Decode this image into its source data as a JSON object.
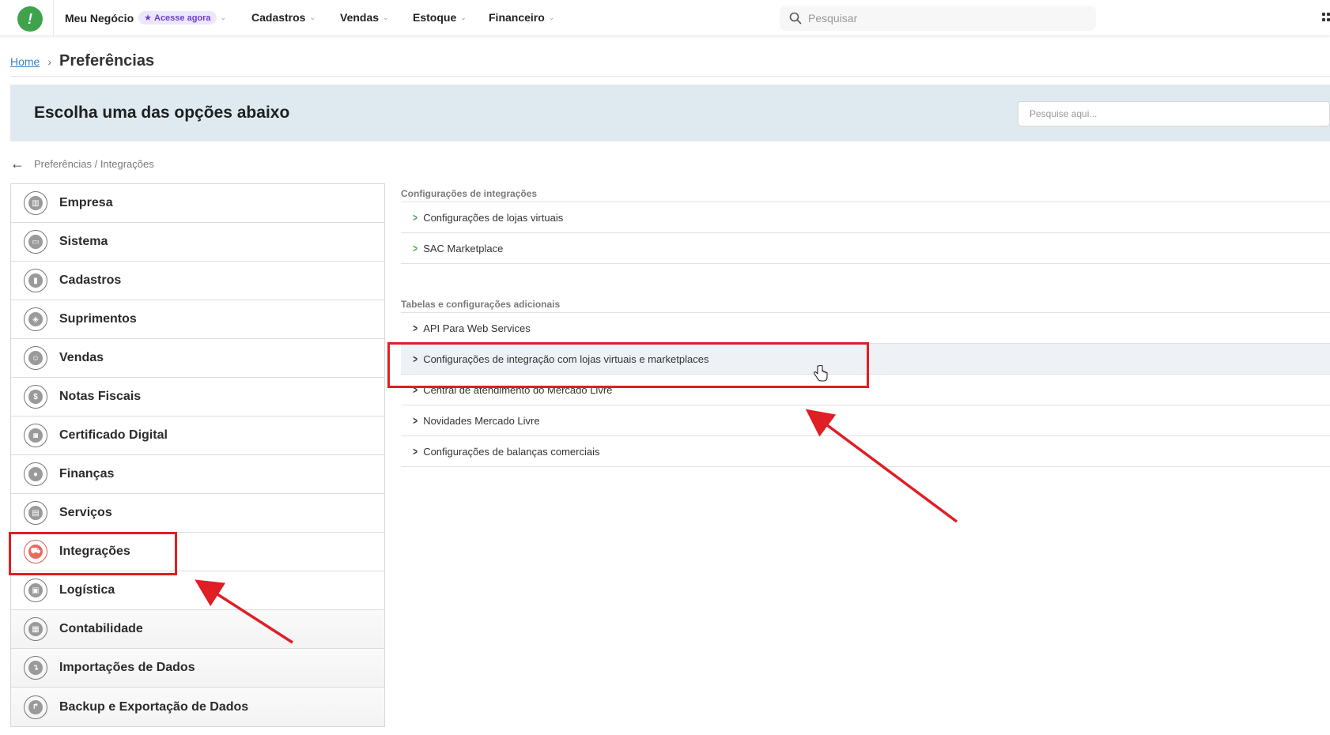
{
  "topnav": {
    "logo_glyph": "!",
    "items": [
      {
        "label": "Meu Negócio",
        "badge": "Acesse agora"
      },
      {
        "label": "Cadastros"
      },
      {
        "label": "Vendas"
      },
      {
        "label": "Estoque"
      },
      {
        "label": "Financeiro"
      }
    ],
    "search_placeholder": "Pesquisar",
    "badge_icon": "star-icon",
    "chevron_icon": "chevron-down-icon"
  },
  "breadcrumb": {
    "home": "Home",
    "current": "Preferências"
  },
  "header": {
    "title": "Escolha uma das opções abaixo",
    "search_placeholder": "Pesquise aqui..."
  },
  "sub_breadcrumb": {
    "path": "Preferências / Integrações"
  },
  "menu": {
    "items": [
      {
        "label": "Empresa",
        "icon": "building-icon",
        "glyph": "▥"
      },
      {
        "label": "Sistema",
        "icon": "monitor-icon",
        "glyph": "▭"
      },
      {
        "label": "Cadastros",
        "icon": "book-icon",
        "glyph": "▮"
      },
      {
        "label": "Suprimentos",
        "icon": "box-icon",
        "glyph": "◈"
      },
      {
        "label": "Vendas",
        "icon": "user-dollar-icon",
        "glyph": "☺"
      },
      {
        "label": "Notas Fiscais",
        "icon": "invoice-icon",
        "glyph": "$"
      },
      {
        "label": "Certificado Digital",
        "icon": "lock-icon",
        "glyph": "◙"
      },
      {
        "label": "Finanças",
        "icon": "piggy-bank-icon",
        "glyph": "●"
      },
      {
        "label": "Serviços",
        "icon": "document-icon",
        "glyph": "▤"
      },
      {
        "label": "Integrações",
        "icon": "integration-car-icon",
        "glyph": "⛟"
      },
      {
        "label": "Logística",
        "icon": "truck-icon",
        "glyph": "▣"
      },
      {
        "label": "Contabilidade",
        "icon": "calculator-icon",
        "glyph": "▦"
      },
      {
        "label": "Importações de Dados",
        "icon": "import-icon",
        "glyph": "↴"
      },
      {
        "label": "Backup e Exportação de Dados",
        "icon": "export-icon",
        "glyph": "↱"
      }
    ],
    "active_index": 9,
    "active_color": "#e05a4e"
  },
  "sections": [
    {
      "title": "Configurações de integrações",
      "links": [
        "Configurações de lojas virtuais",
        "SAC Marketplace"
      ],
      "arrow_color": "#3fa34d"
    },
    {
      "title": "Tabelas e configurações adicionais",
      "links": [
        "API Para Web Services",
        "Configurações de integração com lojas virtuais e marketplaces",
        "Central de atendimento do Mercado Livre",
        "Novidades Mercado Livre",
        "Configurações de balanças comerciais"
      ],
      "arrow_color": "#333333"
    }
  ],
  "annotations": {
    "color": "#e01e25"
  }
}
